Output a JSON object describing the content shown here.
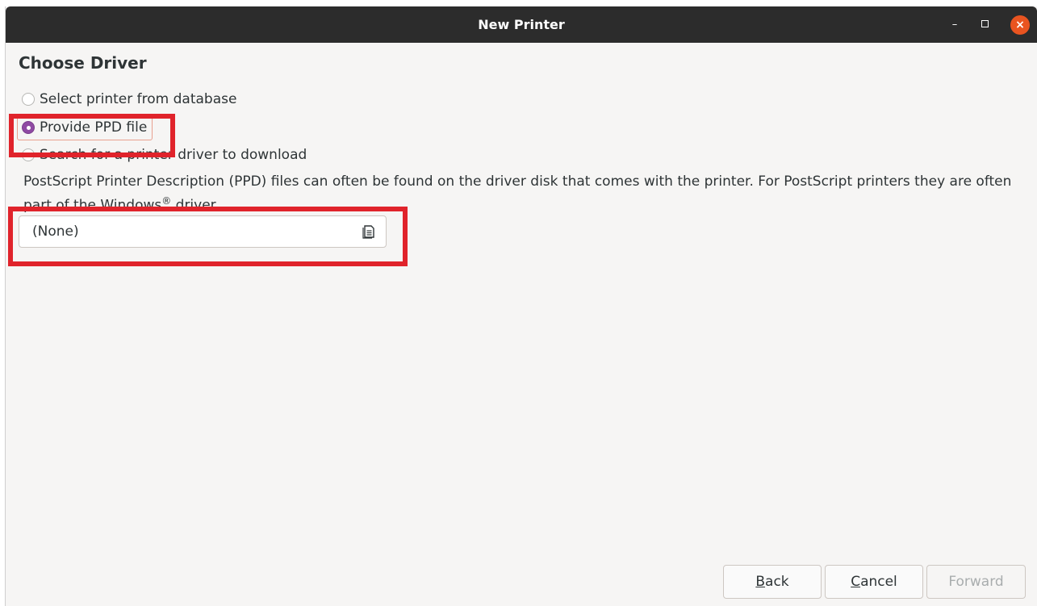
{
  "window": {
    "title": "New Printer",
    "minimize_glyph": "–",
    "close_glyph": "×"
  },
  "page": {
    "heading": "Choose Driver"
  },
  "options": [
    {
      "label": "Select printer from database",
      "checked": false
    },
    {
      "label": "Provide PPD file",
      "checked": true
    },
    {
      "label": "Search for a printer driver to download",
      "checked": false
    }
  ],
  "description": {
    "before": "PostScript Printer Description (PPD) files can often be found on the driver disk that comes with the printer. For PostScript printers they are often part of the Windows",
    "mark": "®",
    "after": " driver."
  },
  "file_chooser": {
    "value": "(None)",
    "icon": "document-icon"
  },
  "buttons": {
    "back": {
      "mnemonic": "B",
      "rest": "ack"
    },
    "cancel": {
      "mnemonic": "C",
      "rest": "ancel"
    },
    "forward": "Forward"
  },
  "colors": {
    "accent": "#8f4aa3",
    "close": "#e95420",
    "highlight": "#e0232b"
  }
}
